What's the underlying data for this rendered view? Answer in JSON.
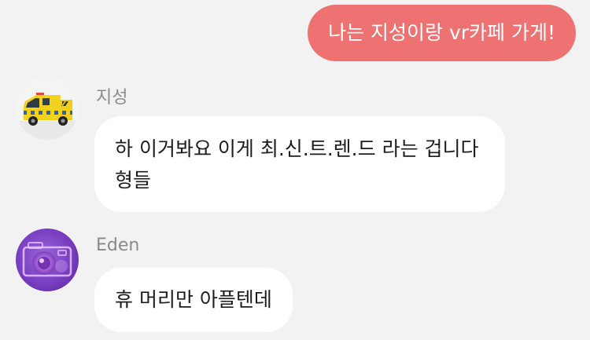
{
  "chat": {
    "outgoing": [
      {
        "text": "나는 지성이랑 vr카페 가게!"
      }
    ],
    "incoming": [
      {
        "sender": "지성",
        "avatar": "ambulance-toy-photo",
        "text": "하 이거봐요 이게 최.신.트.렌.드 라는 겁니다 형들"
      },
      {
        "sender": "Eden",
        "avatar": "purple-camera-photo",
        "text": "휴 머리만 아플텐데"
      }
    ]
  },
  "colors": {
    "background": "#f2f2f2",
    "outgoing_bubble": "#ef7272",
    "incoming_bubble": "#ffffff",
    "sender_name": "#8a8a8a",
    "message_text": "#1c1c1c"
  }
}
